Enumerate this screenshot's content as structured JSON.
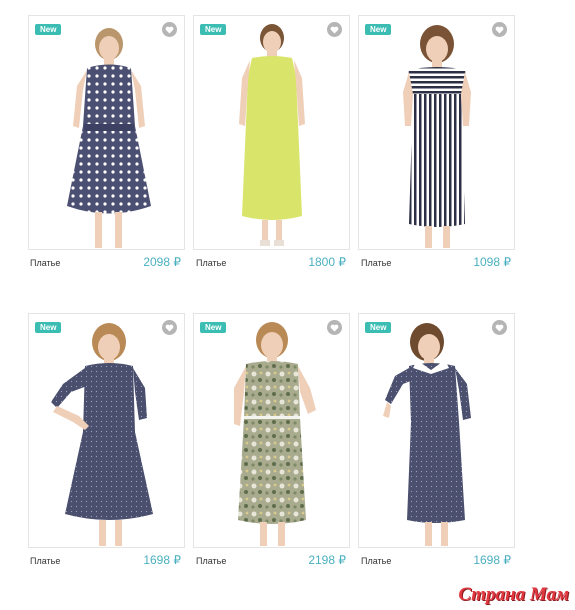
{
  "products": [
    {
      "badge": "New",
      "name": "Платье",
      "price": "2098 ₽",
      "dress_color": "#4b4f72",
      "pattern": "polka-dots"
    },
    {
      "badge": "New",
      "name": "Платье",
      "price": "1800 ₽",
      "dress_color": "#d9e46a",
      "pattern": "plain"
    },
    {
      "badge": "New",
      "name": "Платье",
      "price": "1098 ₽",
      "dress_color": "#2d2f45",
      "pattern": "vertical-stripes"
    },
    {
      "badge": "New",
      "name": "Платье",
      "price": "1698 ₽",
      "dress_color": "#4a4f6d",
      "pattern": "micro-dots"
    },
    {
      "badge": "New",
      "name": "Платье",
      "price": "2198 ₽",
      "dress_color": "#a9ab8e",
      "pattern": "floral"
    },
    {
      "badge": "New",
      "name": "Платье",
      "price": "1698 ₽",
      "dress_color": "#4b506e",
      "pattern": "micro-dots-white-collar"
    }
  ],
  "watermark": "Страна Мам",
  "colors": {
    "badge": "#3bbdb3",
    "price": "#4ab0bf",
    "watermark": "#e2373f"
  }
}
